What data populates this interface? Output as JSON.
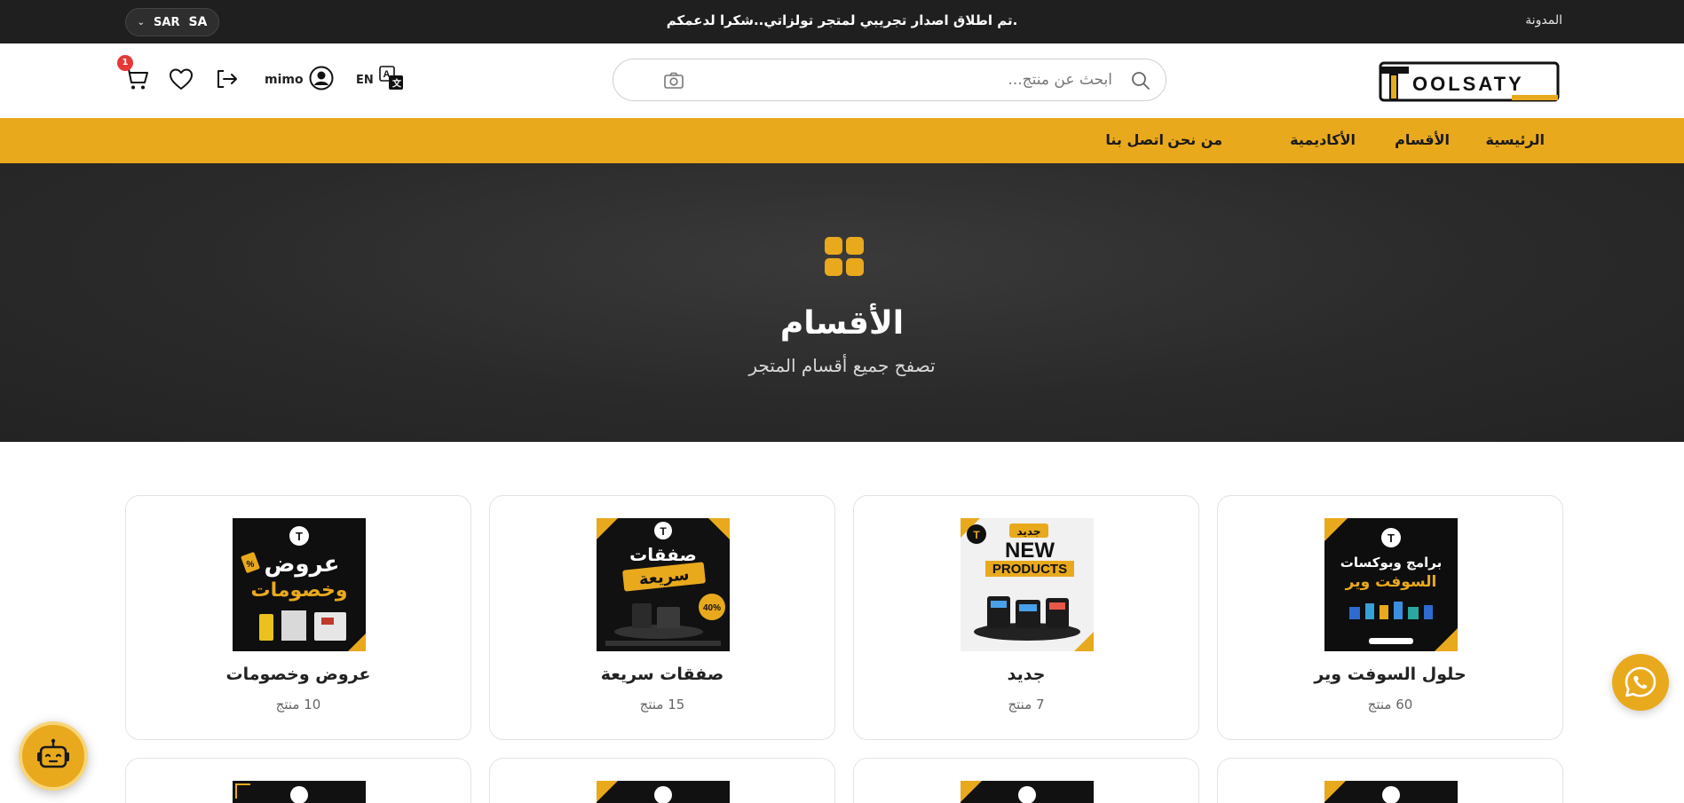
{
  "topbar": {
    "blog_link": "المدونة",
    "announcement": "تم اطلاق اصدار تجريبي لمتجر تولزاتي..شكرا لدعمكم.",
    "currency": "SAR",
    "country": "SA"
  },
  "header": {
    "logo_text": "OOLSATY",
    "search_placeholder": "ابحث عن منتج...",
    "language": "EN",
    "username": "mimo",
    "cart_count": "1"
  },
  "nav": {
    "items": [
      "الرئيسية",
      "الأقسام",
      "الأكاديمية",
      "من نحن",
      "اتصل بنا"
    ]
  },
  "hero": {
    "title": "الأقسام",
    "subtitle": "تصفح جميع أقسام المتجر"
  },
  "categories": [
    {
      "name": "حلول السوفت وير",
      "count": "60 منتج",
      "image_text": [
        "برامج وبوكسات",
        "السوفت وير"
      ]
    },
    {
      "name": "جديد",
      "count": "7 منتج",
      "image_text": [
        "جديد",
        "NEW",
        "PRODUCTS"
      ]
    },
    {
      "name": "صفقات سريعة",
      "count": "15 منتج",
      "image_text": [
        "صفقات",
        "سريعة",
        "40%"
      ]
    },
    {
      "name": "عروض وخصومات",
      "count": "10 منتج",
      "image_text": [
        "عروض",
        "وخصومات",
        "%"
      ]
    }
  ],
  "colors": {
    "brand_yellow": "#e9a91d",
    "dark": "#1f1f1f",
    "badge_red": "#e53935"
  }
}
